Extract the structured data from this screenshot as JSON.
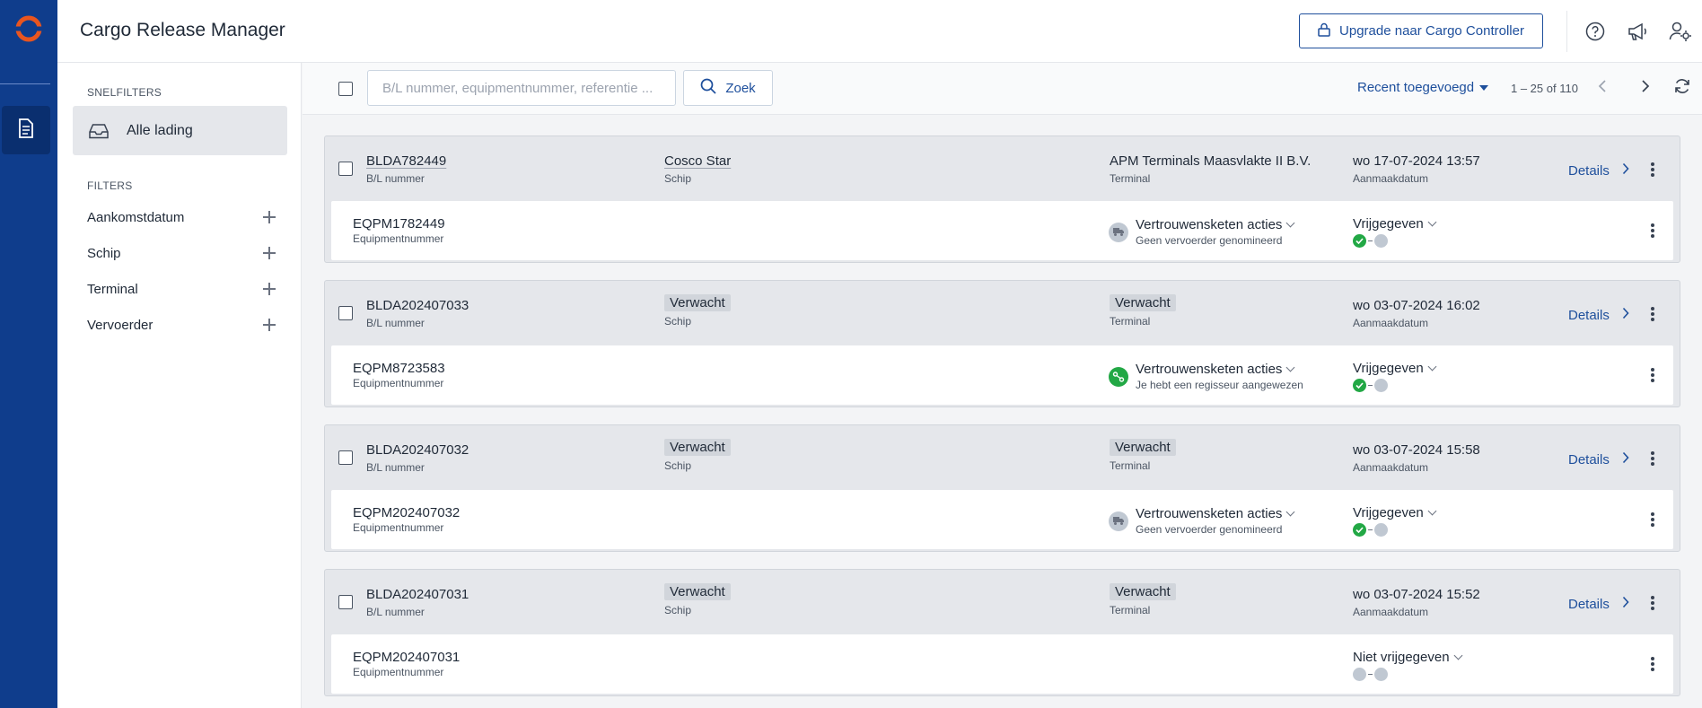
{
  "app": {
    "title": "Cargo Release Manager",
    "upgrade_label": "Upgrade naar Cargo Controller",
    "accent": "#1e4f9c",
    "rail_color": "#0f3d8c",
    "logo_color": "#e8551f"
  },
  "sidebar": {
    "quick_filters_label": "SNELFILTERS",
    "quick_filters": [
      {
        "label": "Alle lading",
        "icon": "inbox-icon"
      }
    ],
    "filters_label": "FILTERS",
    "filters": [
      {
        "label": "Aankomstdatum"
      },
      {
        "label": "Schip"
      },
      {
        "label": "Terminal"
      },
      {
        "label": "Vervoerder"
      }
    ]
  },
  "toolbar": {
    "search_placeholder": "B/L nummer, equipmentnummer, referentie ...",
    "search_button": "Zoek",
    "sort_label": "Recent toegevoegd",
    "range": "1 – 25 of 110"
  },
  "labels": {
    "bl": "B/L nummer",
    "ship": "Schip",
    "terminal": "Terminal",
    "created": "Aanmaakdatum",
    "equipment": "Equipmentnummer",
    "details": "Details",
    "trust_actions": "Vertrouwensketen acties"
  },
  "cargo": [
    {
      "bl_number": "BLDA782449",
      "ship": "Cosco Star",
      "ship_is_tag": false,
      "terminal": "APM Terminals Maasvlakte II B.V.",
      "terminal_is_tag": false,
      "created": "wo 17-07-2024 13:57",
      "equipment": "EQPM1782449",
      "trust": {
        "show": true,
        "status": "Geen vervoerder genomineerd",
        "icon": "truck-icon",
        "color": "#c0c8d2"
      },
      "release": {
        "label": "Vrijgegeven",
        "steps": [
          "ok",
          "off"
        ]
      }
    },
    {
      "bl_number": "BLDA202407033",
      "ship": "Verwacht",
      "ship_is_tag": true,
      "terminal": "Verwacht",
      "terminal_is_tag": true,
      "created": "wo 03-07-2024 16:02",
      "equipment": "EQPM8723583",
      "trust": {
        "show": true,
        "status": "Je hebt een regisseur aangewezen",
        "icon": "handshake-icon",
        "color": "#22a845"
      },
      "release": {
        "label": "Vrijgegeven",
        "steps": [
          "ok",
          "off"
        ]
      }
    },
    {
      "bl_number": "BLDA202407032",
      "ship": "Verwacht",
      "ship_is_tag": true,
      "terminal": "Verwacht",
      "terminal_is_tag": true,
      "created": "wo 03-07-2024 15:58",
      "equipment": "EQPM202407032",
      "trust": {
        "show": true,
        "status": "Geen vervoerder genomineerd",
        "icon": "truck-icon",
        "color": "#c0c8d2"
      },
      "release": {
        "label": "Vrijgegeven",
        "steps": [
          "ok",
          "off"
        ]
      }
    },
    {
      "bl_number": "BLDA202407031",
      "ship": "Verwacht",
      "ship_is_tag": true,
      "terminal": "Verwacht",
      "terminal_is_tag": true,
      "created": "wo 03-07-2024 15:52",
      "equipment": "EQPM202407031",
      "trust": {
        "show": false
      },
      "release": {
        "label": "Niet vrijgegeven",
        "steps": [
          "off",
          "off"
        ]
      }
    }
  ]
}
